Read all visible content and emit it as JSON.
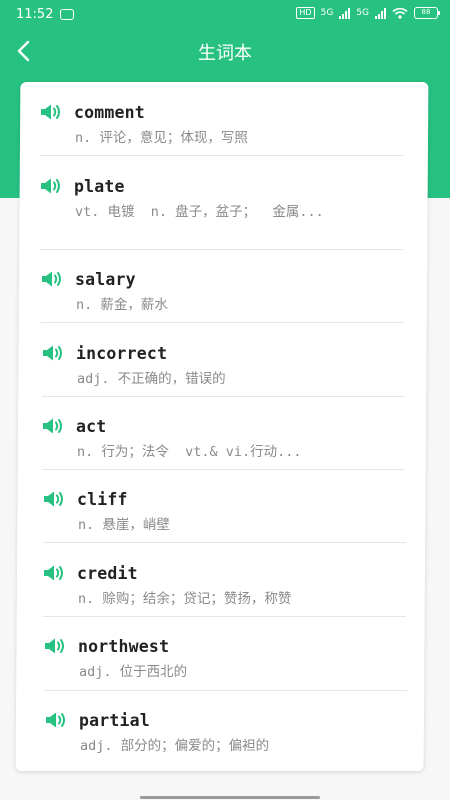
{
  "status": {
    "time": "11:52",
    "network_a": "5G",
    "network_b": "5G",
    "hd": "HD",
    "battery": "88"
  },
  "header": {
    "title": "生词本"
  },
  "colors": {
    "brand": "#27c282",
    "word": "#222222",
    "meaning": "#8a8a8a"
  },
  "words": [
    {
      "word": "comment",
      "meaning": "n. 评论，意见；体现，写照"
    },
    {
      "word": "plate",
      "meaning": "vt. 电镀  n. 盘子，盆子；  金属..."
    },
    {
      "word": "salary",
      "meaning": "n. 薪金，薪水"
    },
    {
      "word": "incorrect",
      "meaning": "adj. 不正确的，错误的"
    },
    {
      "word": "act",
      "meaning": "n. 行为；法令  vt.& vi.行动..."
    },
    {
      "word": "cliff",
      "meaning": "n. 悬崖，峭壁"
    },
    {
      "word": "credit",
      "meaning": "n. 赊购；结余；贷记；赞扬，称赞"
    },
    {
      "word": "northwest",
      "meaning": "adj. 位于西北的"
    },
    {
      "word": "partial",
      "meaning": "adj. 部分的；偏爱的；偏袒的"
    }
  ]
}
